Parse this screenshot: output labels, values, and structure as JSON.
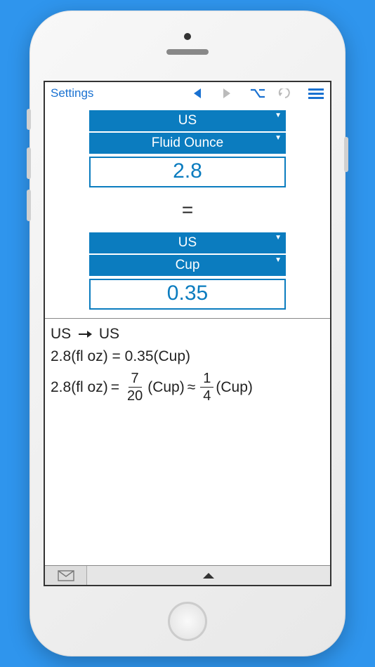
{
  "toolbar": {
    "settings_label": "Settings"
  },
  "from": {
    "system": "US",
    "unit": "Fluid Ounce",
    "value": "2.8"
  },
  "equals_symbol": "=",
  "to": {
    "system": "US",
    "unit": "Cup",
    "value": "0.35"
  },
  "results": {
    "from_system": "US",
    "to_system": "US",
    "line1_left": "2.8(fl oz)",
    "line1_right": "0.35(Cup)",
    "line2_left": "2.8(fl oz)",
    "frac1_num": "7",
    "frac1_den": "20",
    "frac1_unit": "(Cup)",
    "approx": "≈",
    "frac2_num": "1",
    "frac2_den": "4",
    "frac2_unit": "(Cup)"
  }
}
